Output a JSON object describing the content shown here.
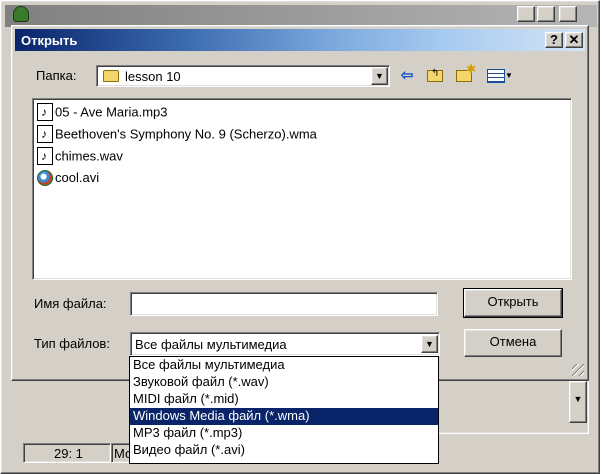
{
  "background_window": {
    "title": "",
    "status_position": "29:  1",
    "status_mode": "Мо"
  },
  "dialog": {
    "title": "Открыть",
    "help_label": "?",
    "close_label": "✕",
    "folder": {
      "label": "Папка:",
      "value": "lesson 10"
    },
    "files": [
      {
        "name": "05 - Ave Maria.mp3",
        "icon": "audio-file-icon"
      },
      {
        "name": "Beethoven's Symphony No. 9 (Scherzo).wma",
        "icon": "audio-file-icon"
      },
      {
        "name": "chimes.wav",
        "icon": "audio-file-icon"
      },
      {
        "name": "cool.avi",
        "icon": "video-file-icon"
      }
    ],
    "filename": {
      "label": "Имя файла:",
      "value": ""
    },
    "filetype": {
      "label": "Тип файлов:",
      "value": "Все файлы мультимедиа",
      "options": [
        "Все файлы мультимедиа",
        "Звуковой файл (*.wav)",
        "MIDI файл (*.mid)",
        "Windows Media файл (*.wma)",
        "MP3 файл (*.mp3)",
        "Видео файл (*.avi)"
      ],
      "highlighted_index": 3
    },
    "buttons": {
      "open": "Открыть",
      "cancel": "Отмена"
    }
  },
  "colors": {
    "face": "#d4d0c8",
    "titlebar_active_start": "#0a246a",
    "titlebar_active_end": "#d4e4f4",
    "selection": "#0a246a"
  }
}
